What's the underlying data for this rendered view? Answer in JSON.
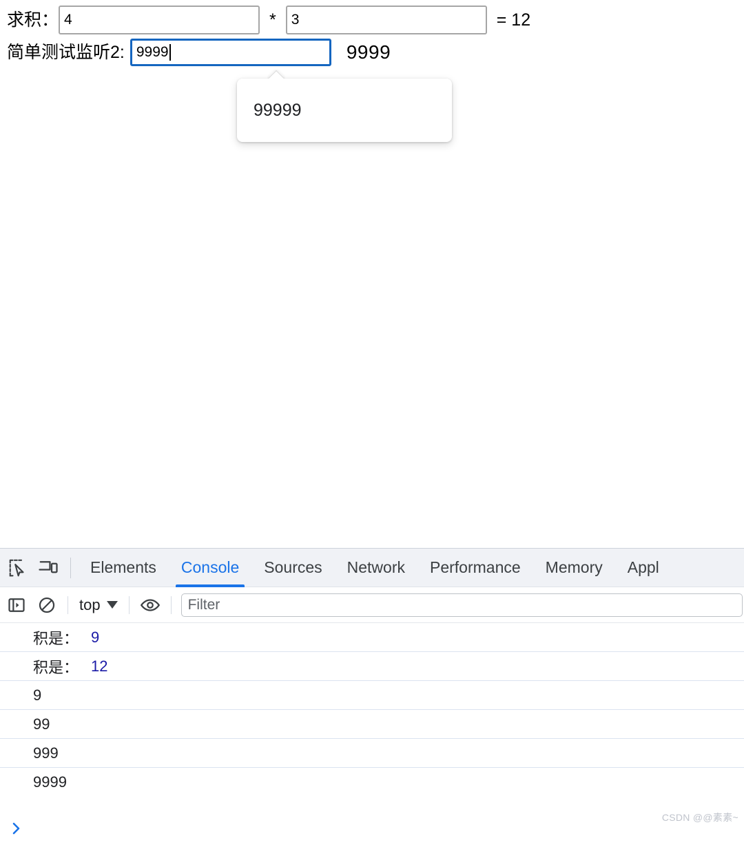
{
  "page": {
    "product_row": {
      "label": "求积：",
      "input_a_value": "4",
      "operator": "*",
      "input_b_value": "3",
      "result": "= 12"
    },
    "listen_row": {
      "label": "简单测试监听2:",
      "input_value": "9999",
      "echo_value": "9999"
    },
    "autocomplete": {
      "item": "99999"
    }
  },
  "devtools": {
    "tabs": [
      {
        "label": "Elements",
        "active": false
      },
      {
        "label": "Console",
        "active": true
      },
      {
        "label": "Sources",
        "active": false
      },
      {
        "label": "Network",
        "active": false
      },
      {
        "label": "Performance",
        "active": false
      },
      {
        "label": "Memory",
        "active": false
      },
      {
        "label": "Appl",
        "active": false
      }
    ],
    "icons": {
      "inspect": "inspect-element-icon",
      "device": "device-toolbar-icon",
      "sidebar": "console-sidebar-icon",
      "clear": "clear-console-icon",
      "eye": "live-expression-eye-icon"
    },
    "console_toolbar": {
      "context": "top",
      "filter_placeholder": "Filter",
      "filter_value": ""
    },
    "console_messages": [
      {
        "label": "积是：",
        "value": "9"
      },
      {
        "label": "积是：",
        "value": "12"
      },
      {
        "label": "9",
        "value": ""
      },
      {
        "label": "99",
        "value": ""
      },
      {
        "label": "999",
        "value": ""
      },
      {
        "label": "9999",
        "value": ""
      }
    ],
    "prompt_symbol": "❯"
  },
  "watermark": "CSDN @@素素~",
  "colors": {
    "accent_blue": "#1a73e8",
    "focus_border": "#1566c0",
    "console_value": "#1a1aa6",
    "tabbar_bg": "#f0f2f6"
  }
}
